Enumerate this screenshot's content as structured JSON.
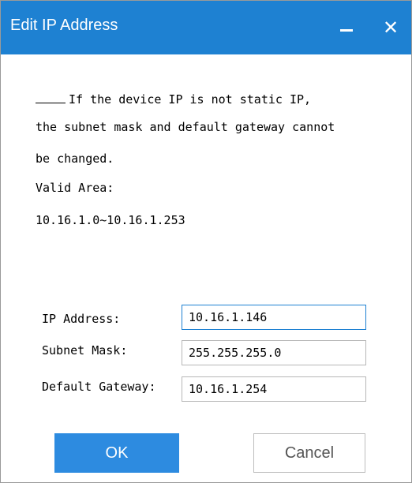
{
  "window": {
    "title": "Edit IP Address",
    "minimize_icon": "minimize-icon",
    "close_icon": "close-icon",
    "close_glyph": "✕"
  },
  "message": {
    "line1": "If the device IP is not static IP,",
    "line2": "the subnet mask and default gateway cannot",
    "line3": "be changed.",
    "line4": "Valid Area:",
    "line5": "10.16.1.0~10.16.1.253"
  },
  "fields": [
    {
      "label": "IP Address:",
      "value": "10.16.1.146"
    },
    {
      "label": "Subnet Mask:",
      "value": "255.255.255.0"
    },
    {
      "label": "Default Gateway:",
      "value": "10.16.1.254"
    }
  ],
  "buttons": {
    "ok": "OK",
    "cancel": "Cancel"
  },
  "colors": {
    "titlebar": "#1e81d2",
    "ok_button": "#2d8be0",
    "text": "#000000"
  }
}
